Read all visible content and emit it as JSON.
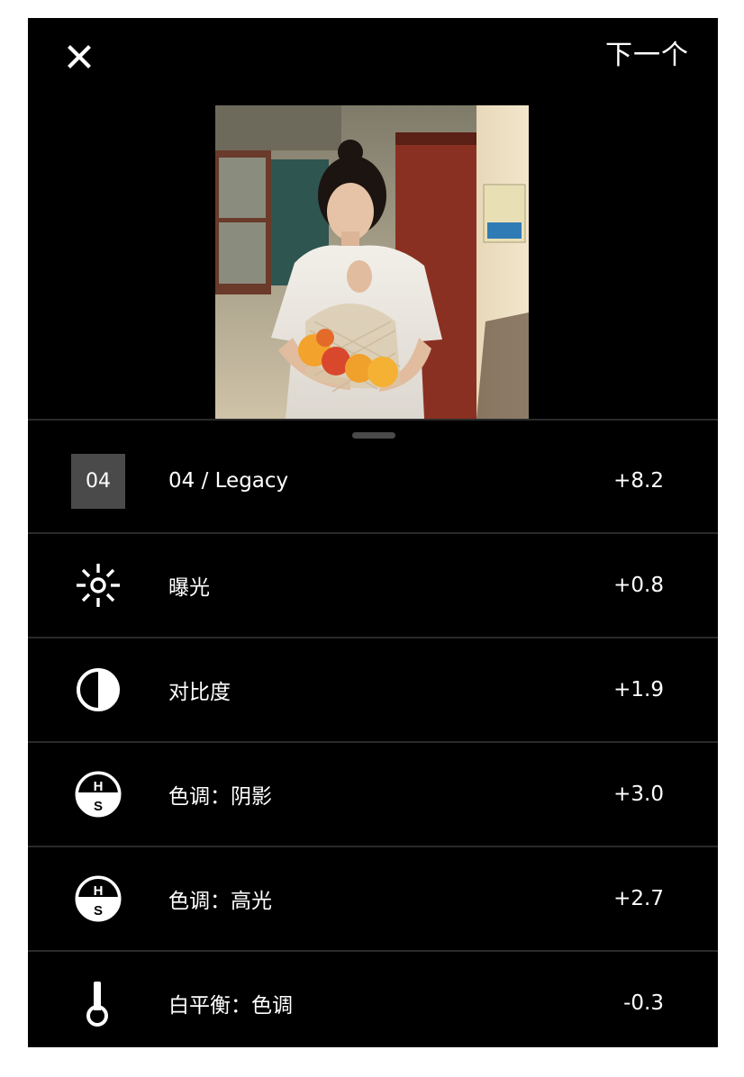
{
  "header": {
    "close_icon": "close-icon",
    "next_label": "下一个"
  },
  "preview": {
    "icon": "photo-preview"
  },
  "adjustments": [
    {
      "icon": "preset-box",
      "preset_code": "04",
      "label": "04 / Legacy",
      "value": "+8.2"
    },
    {
      "icon": "sun-icon",
      "label": "曝光",
      "value": "+0.8"
    },
    {
      "icon": "contrast-icon",
      "label": "对比度",
      "value": "+1.9"
    },
    {
      "icon": "hs-tone-icon",
      "icon_text_top": "H",
      "icon_text_bottom": "S",
      "label": "色调：阴影",
      "value": "+3.0"
    },
    {
      "icon": "hs-tone-icon",
      "icon_text_top": "H",
      "icon_text_bottom": "S",
      "label": "色调：高光",
      "value": "+2.7"
    },
    {
      "icon": "thermometer-icon",
      "label": "白平衡：色调",
      "value": "-0.3"
    }
  ],
  "colors": {
    "background": "#000000",
    "text": "#ffffff",
    "divider": "#2a2a2a",
    "preset_box": "#4a4a4a"
  }
}
